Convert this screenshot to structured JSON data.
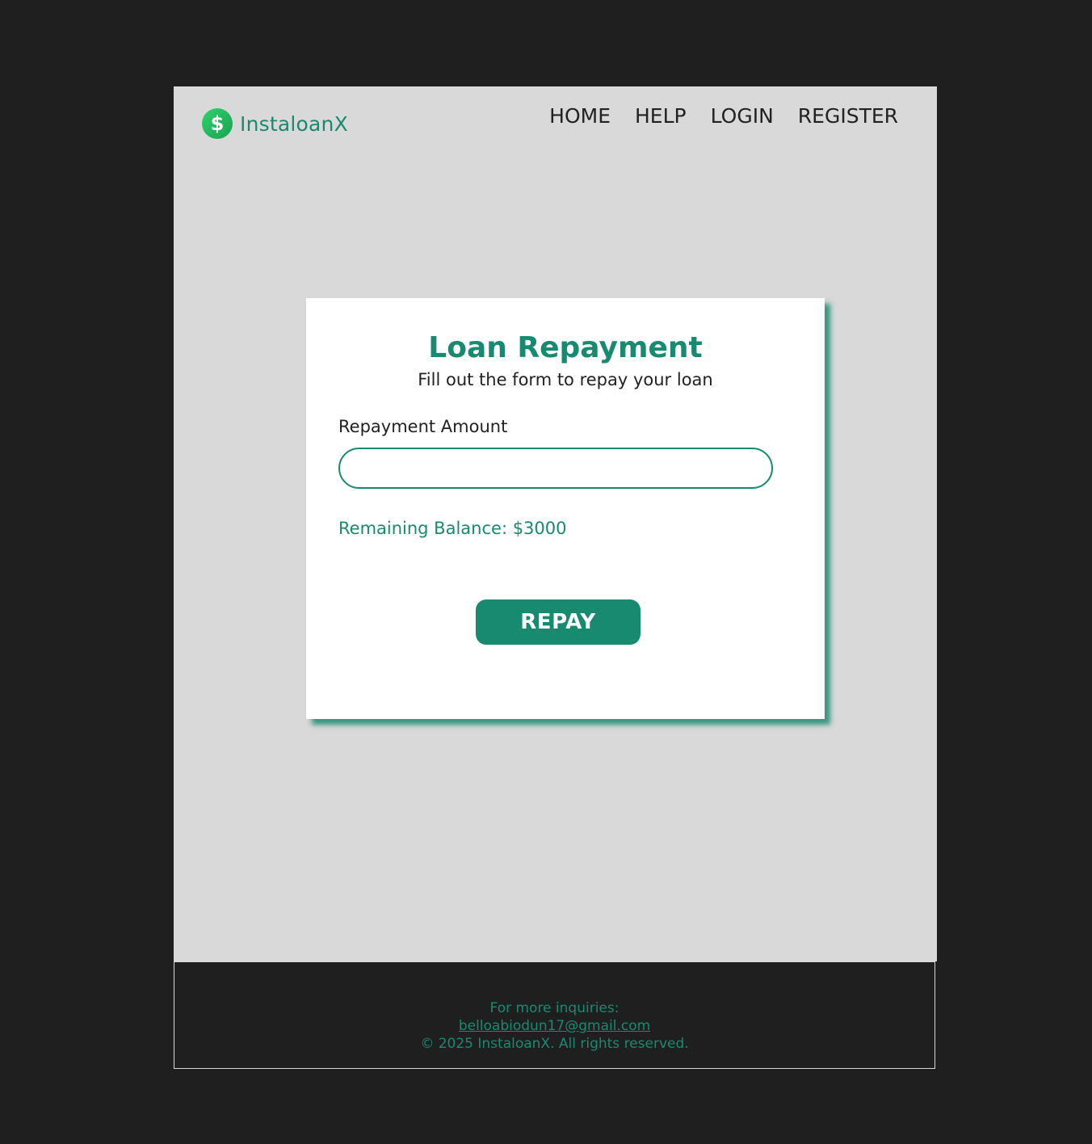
{
  "brand": {
    "icon": "dollar-icon",
    "icon_glyph": "$",
    "name": "InstaloanX"
  },
  "nav": {
    "home": "HOME",
    "help": "HELP",
    "login": "LOGIN",
    "register": "REGISTER"
  },
  "card": {
    "title": "Loan Repayment",
    "subtitle": "Fill out the form to repay your loan",
    "amount_label": "Repayment Amount",
    "amount_value": "",
    "balance_text": "Remaining Balance: $3000",
    "repay_label": "REPAY"
  },
  "footer": {
    "inquiries": "For more inquiries:",
    "email": "belloabiodun17@gmail.com",
    "copyright": "© 2025 InstaloanX. All rights reserved."
  },
  "colors": {
    "accent": "#178a70",
    "page_bg": "#d9d9d9",
    "outer_bg": "#1f1f1f",
    "logo_green": "#1fbf5c"
  }
}
